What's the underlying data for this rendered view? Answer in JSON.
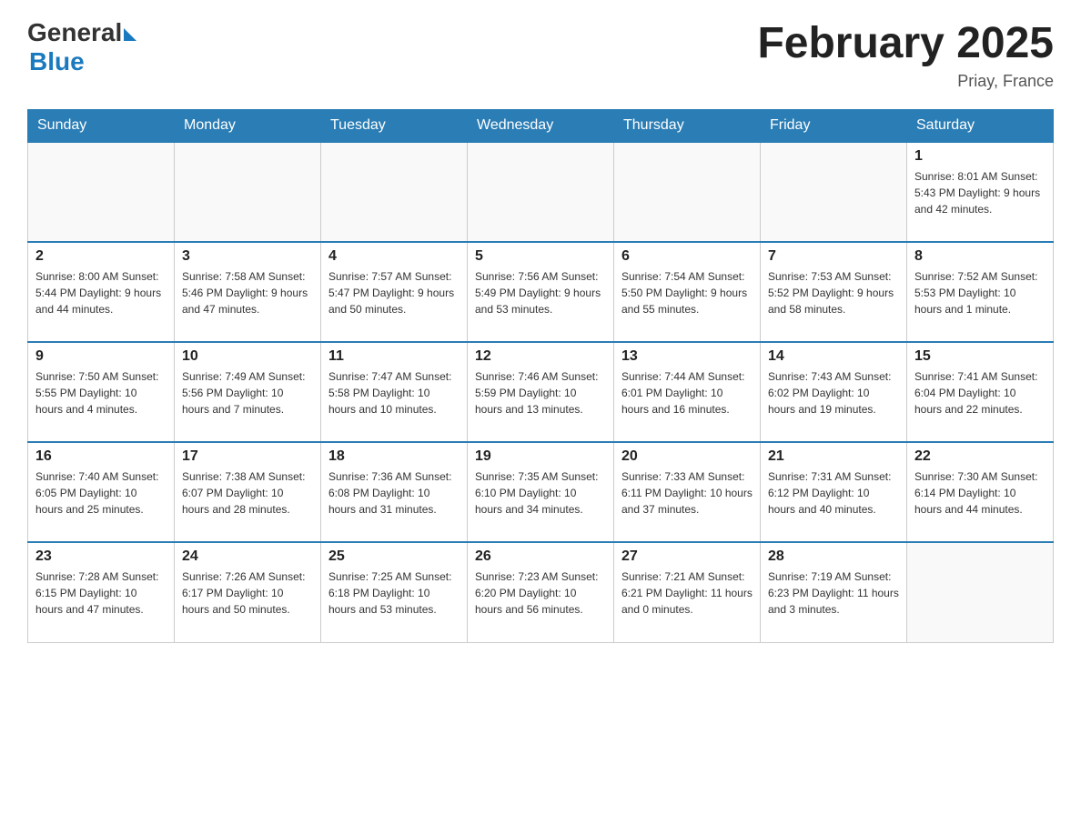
{
  "header": {
    "logo": {
      "general": "General",
      "blue": "Blue"
    },
    "title": "February 2025",
    "location": "Priay, France"
  },
  "days_of_week": [
    "Sunday",
    "Monday",
    "Tuesday",
    "Wednesday",
    "Thursday",
    "Friday",
    "Saturday"
  ],
  "weeks": [
    [
      {
        "day": "",
        "info": ""
      },
      {
        "day": "",
        "info": ""
      },
      {
        "day": "",
        "info": ""
      },
      {
        "day": "",
        "info": ""
      },
      {
        "day": "",
        "info": ""
      },
      {
        "day": "",
        "info": ""
      },
      {
        "day": "1",
        "info": "Sunrise: 8:01 AM\nSunset: 5:43 PM\nDaylight: 9 hours\nand 42 minutes."
      }
    ],
    [
      {
        "day": "2",
        "info": "Sunrise: 8:00 AM\nSunset: 5:44 PM\nDaylight: 9 hours\nand 44 minutes."
      },
      {
        "day": "3",
        "info": "Sunrise: 7:58 AM\nSunset: 5:46 PM\nDaylight: 9 hours\nand 47 minutes."
      },
      {
        "day": "4",
        "info": "Sunrise: 7:57 AM\nSunset: 5:47 PM\nDaylight: 9 hours\nand 50 minutes."
      },
      {
        "day": "5",
        "info": "Sunrise: 7:56 AM\nSunset: 5:49 PM\nDaylight: 9 hours\nand 53 minutes."
      },
      {
        "day": "6",
        "info": "Sunrise: 7:54 AM\nSunset: 5:50 PM\nDaylight: 9 hours\nand 55 minutes."
      },
      {
        "day": "7",
        "info": "Sunrise: 7:53 AM\nSunset: 5:52 PM\nDaylight: 9 hours\nand 58 minutes."
      },
      {
        "day": "8",
        "info": "Sunrise: 7:52 AM\nSunset: 5:53 PM\nDaylight: 10 hours\nand 1 minute."
      }
    ],
    [
      {
        "day": "9",
        "info": "Sunrise: 7:50 AM\nSunset: 5:55 PM\nDaylight: 10 hours\nand 4 minutes."
      },
      {
        "day": "10",
        "info": "Sunrise: 7:49 AM\nSunset: 5:56 PM\nDaylight: 10 hours\nand 7 minutes."
      },
      {
        "day": "11",
        "info": "Sunrise: 7:47 AM\nSunset: 5:58 PM\nDaylight: 10 hours\nand 10 minutes."
      },
      {
        "day": "12",
        "info": "Sunrise: 7:46 AM\nSunset: 5:59 PM\nDaylight: 10 hours\nand 13 minutes."
      },
      {
        "day": "13",
        "info": "Sunrise: 7:44 AM\nSunset: 6:01 PM\nDaylight: 10 hours\nand 16 minutes."
      },
      {
        "day": "14",
        "info": "Sunrise: 7:43 AM\nSunset: 6:02 PM\nDaylight: 10 hours\nand 19 minutes."
      },
      {
        "day": "15",
        "info": "Sunrise: 7:41 AM\nSunset: 6:04 PM\nDaylight: 10 hours\nand 22 minutes."
      }
    ],
    [
      {
        "day": "16",
        "info": "Sunrise: 7:40 AM\nSunset: 6:05 PM\nDaylight: 10 hours\nand 25 minutes."
      },
      {
        "day": "17",
        "info": "Sunrise: 7:38 AM\nSunset: 6:07 PM\nDaylight: 10 hours\nand 28 minutes."
      },
      {
        "day": "18",
        "info": "Sunrise: 7:36 AM\nSunset: 6:08 PM\nDaylight: 10 hours\nand 31 minutes."
      },
      {
        "day": "19",
        "info": "Sunrise: 7:35 AM\nSunset: 6:10 PM\nDaylight: 10 hours\nand 34 minutes."
      },
      {
        "day": "20",
        "info": "Sunrise: 7:33 AM\nSunset: 6:11 PM\nDaylight: 10 hours\nand 37 minutes."
      },
      {
        "day": "21",
        "info": "Sunrise: 7:31 AM\nSunset: 6:12 PM\nDaylight: 10 hours\nand 40 minutes."
      },
      {
        "day": "22",
        "info": "Sunrise: 7:30 AM\nSunset: 6:14 PM\nDaylight: 10 hours\nand 44 minutes."
      }
    ],
    [
      {
        "day": "23",
        "info": "Sunrise: 7:28 AM\nSunset: 6:15 PM\nDaylight: 10 hours\nand 47 minutes."
      },
      {
        "day": "24",
        "info": "Sunrise: 7:26 AM\nSunset: 6:17 PM\nDaylight: 10 hours\nand 50 minutes."
      },
      {
        "day": "25",
        "info": "Sunrise: 7:25 AM\nSunset: 6:18 PM\nDaylight: 10 hours\nand 53 minutes."
      },
      {
        "day": "26",
        "info": "Sunrise: 7:23 AM\nSunset: 6:20 PM\nDaylight: 10 hours\nand 56 minutes."
      },
      {
        "day": "27",
        "info": "Sunrise: 7:21 AM\nSunset: 6:21 PM\nDaylight: 11 hours\nand 0 minutes."
      },
      {
        "day": "28",
        "info": "Sunrise: 7:19 AM\nSunset: 6:23 PM\nDaylight: 11 hours\nand 3 minutes."
      },
      {
        "day": "",
        "info": ""
      }
    ]
  ]
}
